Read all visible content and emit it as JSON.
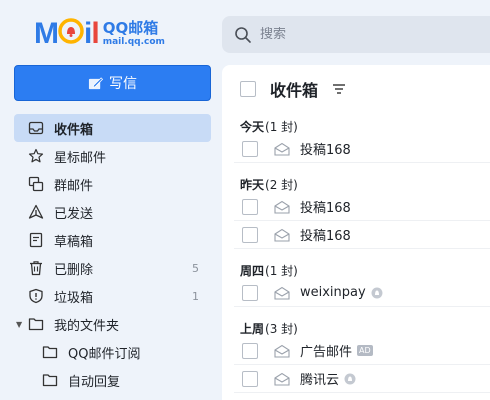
{
  "header": {
    "logo_letters": [
      "M",
      "o",
      "i",
      "l"
    ],
    "logo_qq": "QQ邮箱",
    "logo_url": "mail.qq.com",
    "search_placeholder": "搜索"
  },
  "sidebar": {
    "compose_label": "写信",
    "items": [
      {
        "label": "收件箱",
        "icon": "inbox-icon",
        "active": true,
        "count": ""
      },
      {
        "label": "星标邮件",
        "icon": "star-icon",
        "active": false,
        "count": ""
      },
      {
        "label": "群邮件",
        "icon": "group-mail-icon",
        "active": false,
        "count": ""
      },
      {
        "label": "已发送",
        "icon": "sent-icon",
        "active": false,
        "count": ""
      },
      {
        "label": "草稿箱",
        "icon": "draft-icon",
        "active": false,
        "count": ""
      },
      {
        "label": "已删除",
        "icon": "trash-icon",
        "active": false,
        "count": "5"
      },
      {
        "label": "垃圾箱",
        "icon": "spam-icon",
        "active": false,
        "count": "1"
      }
    ],
    "my_folders_label": "我的文件夹",
    "folders": [
      {
        "label": "QQ邮件订阅"
      },
      {
        "label": "自动回复"
      }
    ]
  },
  "mail_list": {
    "title": "收件箱",
    "groups": [
      {
        "label": "今天",
        "count": "(1 封)",
        "rows": [
          {
            "subject": "投稿168",
            "tag": "",
            "bell": false
          }
        ]
      },
      {
        "label": "昨天",
        "count": "(2 封)",
        "rows": [
          {
            "subject": "投稿168",
            "tag": "",
            "bell": false
          },
          {
            "subject": "投稿168",
            "tag": "",
            "bell": false
          }
        ]
      },
      {
        "label": "周四",
        "count": "(1 封)",
        "rows": [
          {
            "subject": "weixinpay",
            "tag": "",
            "bell": true
          }
        ]
      },
      {
        "label": "上周",
        "count": "(3 封)",
        "rows": [
          {
            "subject": "广告邮件",
            "tag": "AD",
            "bell": false
          },
          {
            "subject": "腾讯云",
            "tag": "",
            "bell": true
          }
        ]
      }
    ]
  },
  "colors": {
    "accent": "#2c7df2",
    "active_bg": "#c8dbf6",
    "page_bg": "#eef3fa"
  }
}
